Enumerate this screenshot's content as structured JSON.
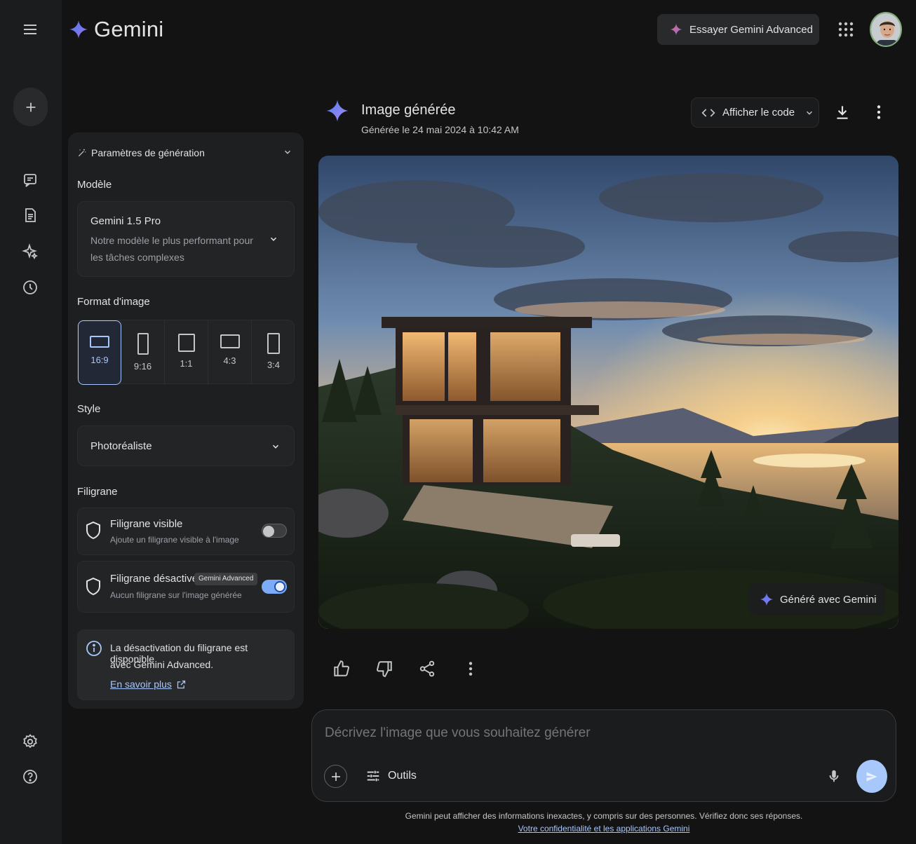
{
  "header": {
    "brand": "Gemini",
    "try_advanced": "Essayer Gemini Advanced"
  },
  "panel": {
    "title": "Paramètres de génération",
    "model_label": "Modèle",
    "model_name": "Gemini 1.5 Pro",
    "model_desc_1": "Notre modèle le plus performant pour",
    "model_desc_2": "les tâches complexes",
    "format_label": "Format d'image",
    "formats": [
      "16:9",
      "9:16",
      "1:1",
      "4:3",
      "3:4"
    ],
    "selected_format": "16:9",
    "style_label": "Style",
    "style_value": "Photoréaliste",
    "watermark_label": "Filigrane",
    "wm_visible_title": "Filigrane visible",
    "wm_visible_desc": "Ajoute un filigrane visible à l'image",
    "wm_visible_on": false,
    "wm_off_title": "Filigrane désactivé",
    "wm_off_badge": "Gemini Advanced",
    "wm_off_desc": "Aucun filigrane sur l'image générée",
    "wm_off_on": true,
    "info_1": "La désactivation du filigrane est disponible",
    "info_2": "avec Gemini Advanced.",
    "info_link": "En savoir plus"
  },
  "main": {
    "title": "Image générée",
    "date": "Générée le 24 mai 2024 à 10:42 AM",
    "code_button": "Afficher le code",
    "generated_badge": "Généré avec Gemini"
  },
  "composer": {
    "placeholder": "Décrivez l'image que vous souhaitez générer",
    "tools_label": "Outils"
  },
  "footer": {
    "disclaimer": "Gemini peut afficher des informations inexactes, y compris sur des personnes. Vérifiez donc ses réponses.",
    "privacy_link": "Votre confidentialité et les applications Gemini"
  },
  "colors": {
    "accent": "#a8c7fa",
    "toggle_on": "#7cacf8",
    "background": "#131314",
    "panel": "#1e1f20"
  }
}
